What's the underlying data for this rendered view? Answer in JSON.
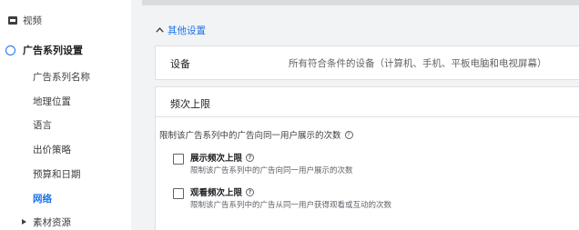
{
  "sidebar": {
    "video_label": "视频",
    "section_title": "广告系列设置",
    "items": [
      {
        "label": "广告系列名称"
      },
      {
        "label": "地理位置"
      },
      {
        "label": "语言"
      },
      {
        "label": "出价策略"
      },
      {
        "label": "预算和日期"
      },
      {
        "label": "网络",
        "active": true
      }
    ],
    "assets_label": "素材资源"
  },
  "main": {
    "other_settings_link": "其他设置",
    "device": {
      "label": "设备",
      "value": "所有符合条件的设备（计算机、手机、平板电脑和电视屏幕）"
    },
    "frequency": {
      "title": "频次上限",
      "description": "限制该广告系列中的广告向同一用户展示的次数",
      "options": [
        {
          "title": "展示频次上限",
          "description": "限制该广告系列中的广告向同一用户展示的次数",
          "checked": false
        },
        {
          "title": "观看频次上限",
          "description": "限制该广告系列中的广告从同一用户获得观看或互动的次数",
          "checked": false
        }
      ]
    }
  },
  "colors": {
    "accent": "#1a73e8",
    "background": "#f1f3f4",
    "card": "#ffffff"
  },
  "icons": [
    "video-icon",
    "circle-icon",
    "chevron-up-icon",
    "help-icon",
    "triangle-right-icon",
    "checkbox"
  ]
}
